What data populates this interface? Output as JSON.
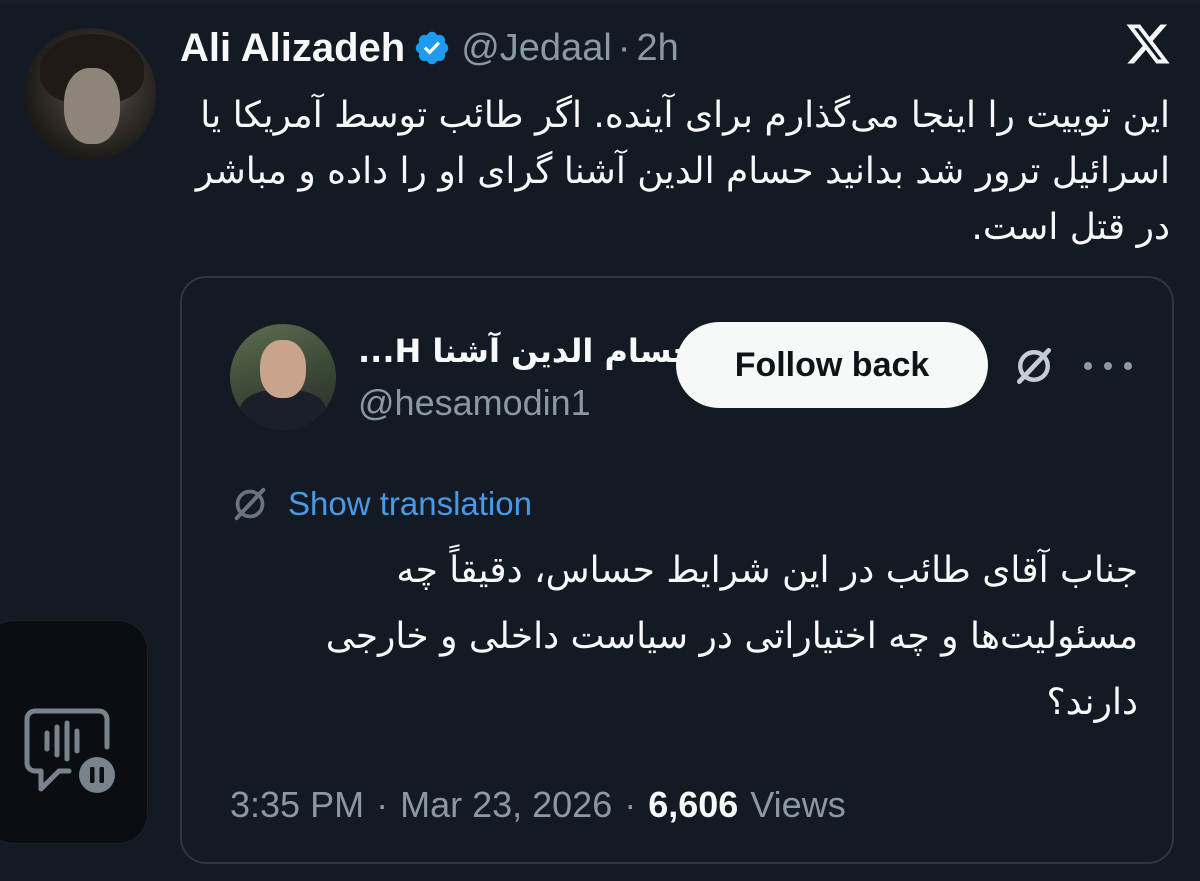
{
  "post": {
    "author_name": "Ali Alizadeh",
    "handle": "@Jedaal",
    "separator": "·",
    "time": "2h",
    "text": "این توییت را اینجا می‌گذارم برای آینده. اگر طائب توسط آمریکا یا اسرائیل ترور شد بدانید حسام الدین آشنا گرای او را داده و مباشر در قتل است."
  },
  "quote": {
    "name": "حسام الدین آشنا H...",
    "handle": "@hesamodin1",
    "follow_label": "Follow back",
    "translate_label": "Show translation",
    "text": "جناب آقای طائب در این شرایط حساس، دقیقاً چه مسئولیت‌ها و چه اختیاراتی در سیاست داخلی و خارجی دارند؟",
    "time": "3:35 PM",
    "date": "Mar 23, 2026",
    "separator": "·",
    "views_count": "6,606",
    "views_label": "Views"
  },
  "icons": {
    "verified": "verified-badge-icon",
    "x_logo": "x-logo-icon",
    "grok": "grok-icon",
    "more": "more-icon",
    "translate": "translate-icon",
    "audio": "audio-message-icon"
  },
  "colors": {
    "background": "#141a23",
    "link": "#4a99e9",
    "verified": "#1d9bf0",
    "muted": "#8b98a5"
  }
}
